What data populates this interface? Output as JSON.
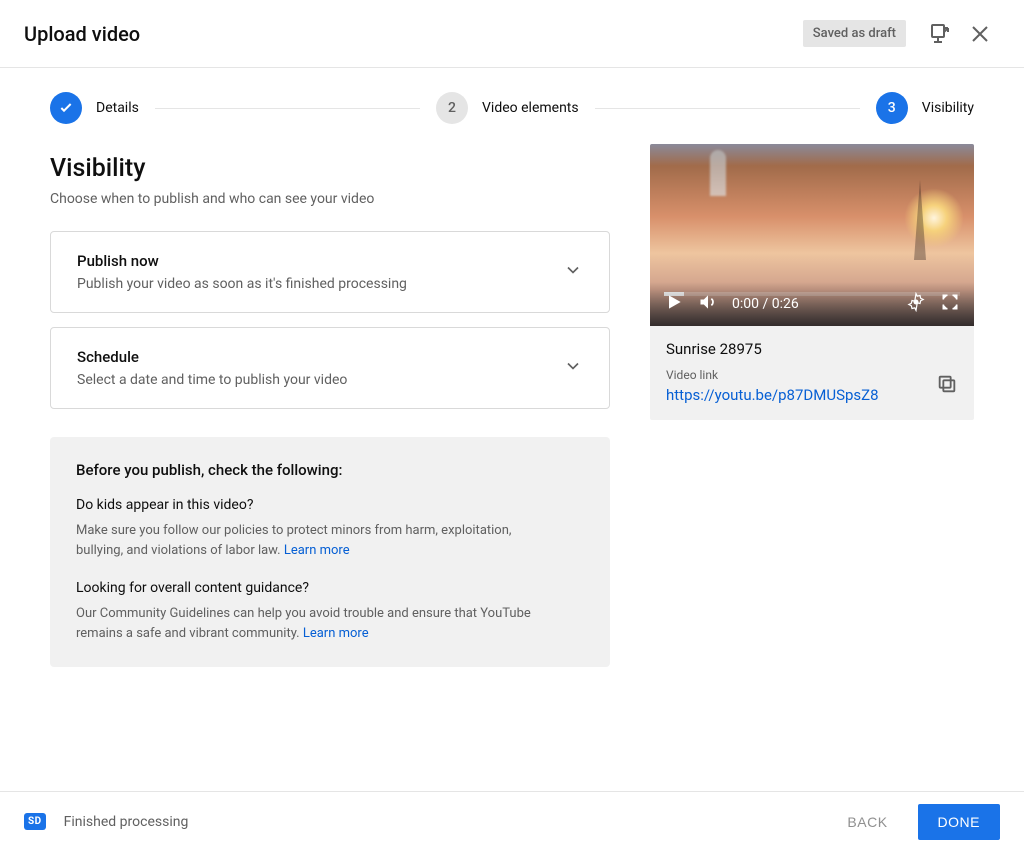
{
  "header": {
    "title": "Upload video",
    "status_badge": "Saved as draft"
  },
  "stepper": {
    "steps": [
      {
        "number": "1",
        "label": "Details",
        "state": "done"
      },
      {
        "number": "2",
        "label": "Video elements",
        "state": "inactive"
      },
      {
        "number": "3",
        "label": "Visibility",
        "state": "active"
      }
    ]
  },
  "visibility": {
    "title": "Visibility",
    "subtitle": "Choose when to publish and who can see your video",
    "publish_now": {
      "title": "Publish now",
      "desc": "Publish your video as soon as it's finished processing"
    },
    "schedule": {
      "title": "Schedule",
      "desc": "Select a date and time to publish your video"
    }
  },
  "infobox": {
    "title": "Before you publish, check the following:",
    "q1": "Do kids appear in this video?",
    "p1": "Make sure you follow our policies to protect minors from harm, exploitation, bullying, and violations of labor law. ",
    "p1_link": "Learn more",
    "q2": "Looking for overall content guidance?",
    "p2": "Our Community Guidelines can help you avoid trouble and ensure that YouTube remains a safe and vibrant community. ",
    "p2_link": "Learn more"
  },
  "preview": {
    "time_text": "0:00 / 0:26",
    "video_title": "Sunrise 28975",
    "link_label": "Video link",
    "link_value": "https://youtu.be/p87DMUSpsZ8"
  },
  "footer": {
    "sd_label": "SD",
    "status": "Finished processing",
    "back": "BACK",
    "done": "DONE"
  }
}
